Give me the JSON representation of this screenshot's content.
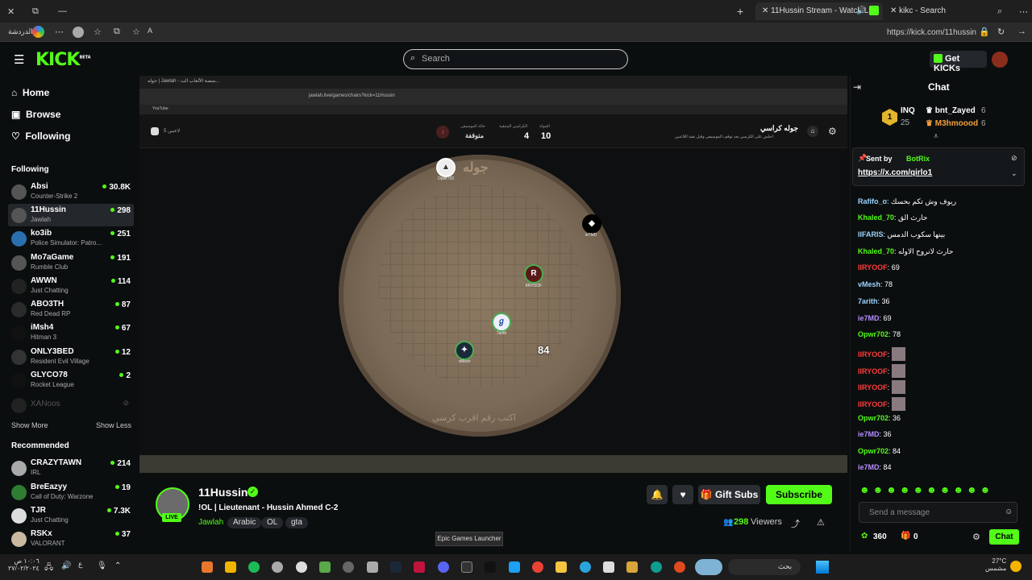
{
  "browser": {
    "tabs": [
      {
        "label": "11Hussin Stream - Watch Live",
        "active": true
      },
      {
        "label": "kikc - Search",
        "active": false
      }
    ],
    "profile_label": "الدردشة",
    "url": "https://kick.com/11hussin"
  },
  "kick": {
    "logo": "KICK",
    "logo_badge": "BETA",
    "search_placeholder": "Search",
    "get_kicks_label": "Get KICKs",
    "accent": "#53fc18"
  },
  "sidebar": {
    "nav": [
      {
        "label": "Home",
        "icon": "home-icon"
      },
      {
        "label": "Browse",
        "icon": "browse-icon"
      },
      {
        "label": "Following",
        "icon": "heart-icon"
      }
    ],
    "following_title": "Following",
    "following": [
      {
        "name": "Absi",
        "category": "Counter-Strike 2",
        "viewers": "30.8K"
      },
      {
        "name": "11Hussin",
        "category": "Jawlah",
        "viewers": "298"
      },
      {
        "name": "ko3ib",
        "category": "Police Simulator: Patro...",
        "viewers": "251"
      },
      {
        "name": "Mo7aGame",
        "category": "Rumble Club",
        "viewers": "191"
      },
      {
        "name": "AWWN",
        "category": "Just Chatting",
        "viewers": "114"
      },
      {
        "name": "ABO3TH",
        "category": "Red Dead RP",
        "viewers": "87"
      },
      {
        "name": "iMsh4",
        "category": "Hitman 3",
        "viewers": "67"
      },
      {
        "name": "ONLY3BED",
        "category": "Resident Evil Village",
        "viewers": "12"
      },
      {
        "name": "GLYCO78",
        "category": "Rocket League",
        "viewers": "2"
      },
      {
        "name": "XANoos",
        "category": "",
        "viewers": ""
      }
    ],
    "show_more": "Show More",
    "show_less": "Show Less",
    "recommended_title": "Recommended",
    "recommended": [
      {
        "name": "CRAZYTAWN",
        "category": "IRL",
        "viewers": "214"
      },
      {
        "name": "BreEazyy",
        "category": "Call of Duty: Warzone",
        "viewers": "19"
      },
      {
        "name": "TJR",
        "category": "Just Chatting",
        "viewers": "7.3K"
      },
      {
        "name": "RSKx",
        "category": "VALORANT",
        "viewers": "37"
      }
    ]
  },
  "stream": {
    "inner_tab": "جوله | Jawlah - منصة الألعاب الت...",
    "inner_url": "jawlah.live/games/chairs?kick=11Hussin",
    "youtube_label": "YouTube",
    "game_title": "جوله كراسي",
    "game_subtitle": "اجلس على الكرسي بعد توقف الموسيقى وقبل بقية اللاعبين",
    "stat1_label": "الجولة",
    "stat1_value": "10",
    "stat2_label": "الكراسي المتبقية",
    "stat2_value": "4",
    "stat3_label": "حالة الموسيقى",
    "stat3_value": "متوقفة",
    "players_online": "5 لاعبين",
    "board_watermark": "جوله",
    "board_hint": "اكتب رقم اقرب كرسي",
    "chair_number": "84",
    "players": [
      {
        "label": "Opwr702"
      },
      {
        "label": "ie7MD"
      },
      {
        "label": "IIRYOOF"
      },
      {
        "label": "7arith"
      },
      {
        "label": "vMesh"
      }
    ]
  },
  "info": {
    "channel": "11Hussin",
    "live": "LIVE",
    "title": "!OL | Lieutenant - Hussin Ahmed C-2",
    "category": "Jawlah",
    "tags": [
      "Arabic",
      "OL",
      "gta"
    ],
    "gift_subs": "Gift Subs",
    "subscribe": "Subscribe",
    "viewers": "298",
    "viewers_label": "Viewers",
    "tooltip": "Epic Games Launcher"
  },
  "chat": {
    "title": "Chat",
    "leaderboard": {
      "top_name": "INQ",
      "top_count": "25",
      "second_name": "bnt_Zayed",
      "second_count": "6",
      "third_name": "M3hmoood",
      "third_count": "6"
    },
    "pinned_sender_label": "Sent by",
    "pinned_sender": "BotRix",
    "pinned_link": "https://x.com/qirlo1",
    "messages": [
      {
        "user": "Rafifo_o",
        "text": "ريوف وش تكم بحسك",
        "color": "#9bd3ff"
      },
      {
        "user": "Khaled_70",
        "text": "حارث الق",
        "color": "#53fc18"
      },
      {
        "user": "IIFARIS",
        "text": "بينها سكوب الدمس",
        "color": "#9bd3ff"
      },
      {
        "user": "Khaled_70",
        "text": "حارث لانروح الاوله",
        "color": "#53fc18"
      },
      {
        "user": "IIRYOOF",
        "text": "69",
        "color": "#ff3b3b"
      },
      {
        "user": "vMesh",
        "text": "78",
        "color": "#9bd3ff"
      },
      {
        "user": "7arith",
        "text": "36",
        "color": "#9bd3ff"
      },
      {
        "user": "ie7MD",
        "text": "69",
        "color": "#b58cff"
      },
      {
        "user": "Opwr702",
        "text": "78",
        "color": "#53fc18"
      },
      {
        "user": "IIRYOOF",
        "text": "",
        "color": "#ff3b3b"
      },
      {
        "user": "IIRYOOF",
        "text": "",
        "color": "#ff3b3b"
      },
      {
        "user": "IIRYOOF",
        "text": "",
        "color": "#ff3b3b"
      },
      {
        "user": "IIRYOOF",
        "text": "",
        "color": "#ff3b3b"
      },
      {
        "user": "Opwr702",
        "text": "36",
        "color": "#53fc18"
      },
      {
        "user": "ie7MD",
        "text": "36",
        "color": "#b58cff"
      },
      {
        "user": "Opwr702",
        "text": "84",
        "color": "#53fc18"
      },
      {
        "user": "ie7MD",
        "text": "84",
        "color": "#b58cff"
      }
    ],
    "input_placeholder": "Send a message",
    "points": "360",
    "gifts": "0",
    "chat_button": "Chat"
  },
  "taskbar": {
    "weather_temp": "27°C",
    "weather_desc": "مشمس",
    "search_label": "بحث",
    "time": "١٠:٠٦ ص",
    "date": "٢٧/٠٢/٢٠٢٤",
    "lang": "ع"
  }
}
